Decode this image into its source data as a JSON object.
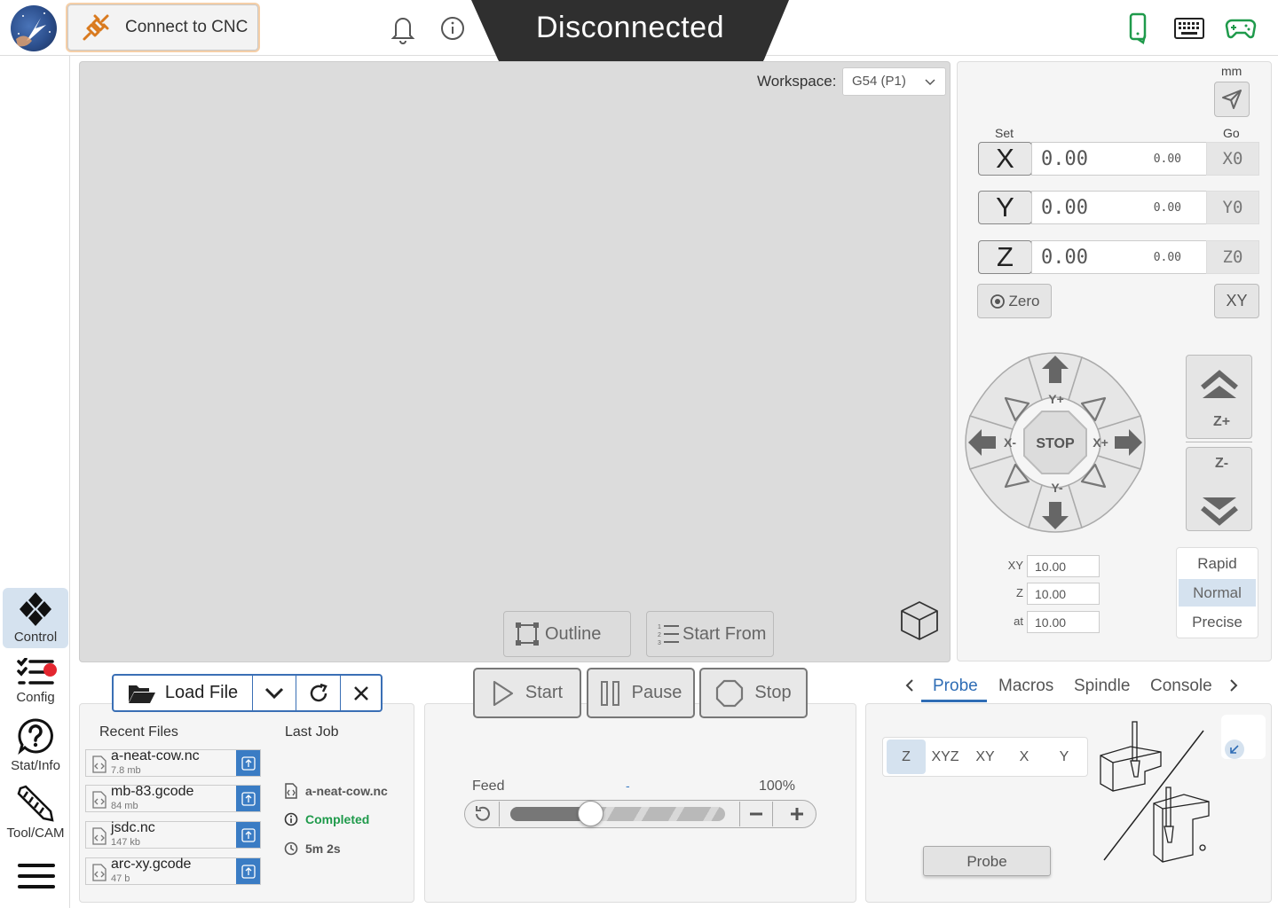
{
  "header": {
    "connect_label": "Connect to CNC",
    "status": "Disconnected"
  },
  "sidebar": {
    "items": [
      {
        "label": "Control",
        "icon": "control-icon",
        "active": true
      },
      {
        "label": "Config",
        "icon": "config-list-icon"
      },
      {
        "label": "Stat/Info",
        "icon": "help-icon",
        "notification": true
      },
      {
        "label": "Tool/CAM",
        "icon": "tool-cam-icon"
      }
    ]
  },
  "visualizer": {
    "workspace_label": "Workspace:",
    "workspace_value": "G54 (P1)",
    "outline_label": "Outline",
    "start_from_label": "Start From"
  },
  "dro": {
    "unit": "mm",
    "set_label": "Set",
    "go_label": "Go",
    "axes": [
      {
        "axis": "X",
        "value": "0.00",
        "machine": "0.00",
        "go": "X0"
      },
      {
        "axis": "Y",
        "value": "0.00",
        "machine": "0.00",
        "go": "Y0"
      },
      {
        "axis": "Z",
        "value": "0.00",
        "machine": "0.00",
        "go": "Z0"
      }
    ],
    "zero_label": "Zero",
    "xy_label": "XY"
  },
  "jog": {
    "stop_label": "STOP",
    "y_plus": "Y+",
    "y_minus": "Y-",
    "x_plus": "X+",
    "x_minus": "X-",
    "z_plus": "Z+",
    "z_minus": "Z-",
    "steps": [
      {
        "label": "XY",
        "value": "10.00"
      },
      {
        "label": "Z",
        "value": "10.00"
      },
      {
        "label": "at",
        "value": "10.00"
      }
    ],
    "speeds": [
      "Rapid",
      "Normal",
      "Precise"
    ],
    "selected_speed": "Normal"
  },
  "files": {
    "load_label": "Load File",
    "recent_title": "Recent Files",
    "recent": [
      {
        "name": "a-neat-cow.nc",
        "size": "7.8 mb"
      },
      {
        "name": "mb-83.gcode",
        "size": "84 mb"
      },
      {
        "name": "jsdc.nc",
        "size": "147 kb"
      },
      {
        "name": "arc-xy.gcode",
        "size": "47 b"
      }
    ],
    "last_job_title": "Last Job",
    "last_job_file": "a-neat-cow.nc",
    "last_job_status": "Completed",
    "last_job_time": "5m 2s"
  },
  "run": {
    "start_label": "Start",
    "pause_label": "Pause",
    "stop_label": "Stop",
    "feed_label": "Feed",
    "feed_value": "-",
    "feed_percent": "100%",
    "feed_slider_fraction": 0.37
  },
  "tabs": {
    "items": [
      "Probe",
      "Macros",
      "Spindle",
      "Console"
    ],
    "active": "Probe"
  },
  "probe": {
    "axes": [
      "Z",
      "XYZ",
      "XY",
      "X",
      "Y"
    ],
    "selected": "Z",
    "button_label": "Probe"
  },
  "colors": {
    "accent": "#2f6db5",
    "banner": "#2f2f2f",
    "connect_plug": "#d97a1f",
    "completed": "#1f9a4b",
    "notification": "#e3262f",
    "header_icons": "#1f9a4b"
  }
}
